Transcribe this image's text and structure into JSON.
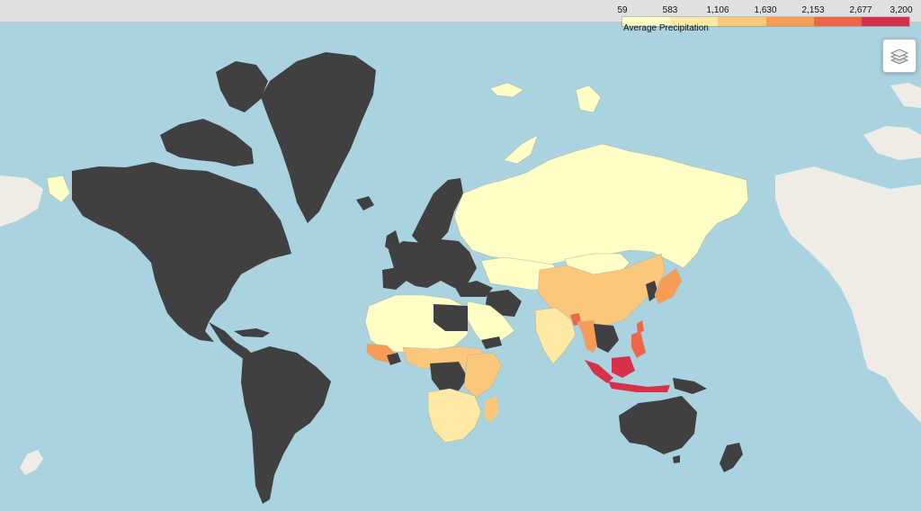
{
  "legend": {
    "title": "Average Precipitation",
    "ticks": [
      "59",
      "583",
      "1,106",
      "1,630",
      "2,153",
      "2,677",
      "3,200"
    ],
    "colors": [
      "#ffffc6",
      "#fde9a2",
      "#fbc77a",
      "#f79c55",
      "#ee6646",
      "#d7304a"
    ]
  },
  "colors": {
    "ocean": "#a9d3de",
    "no_data": "#404040",
    "unmapped_land": "#efece6",
    "border": "#b9b9aa"
  },
  "controls": {
    "layers_icon": "layers-icon"
  }
}
